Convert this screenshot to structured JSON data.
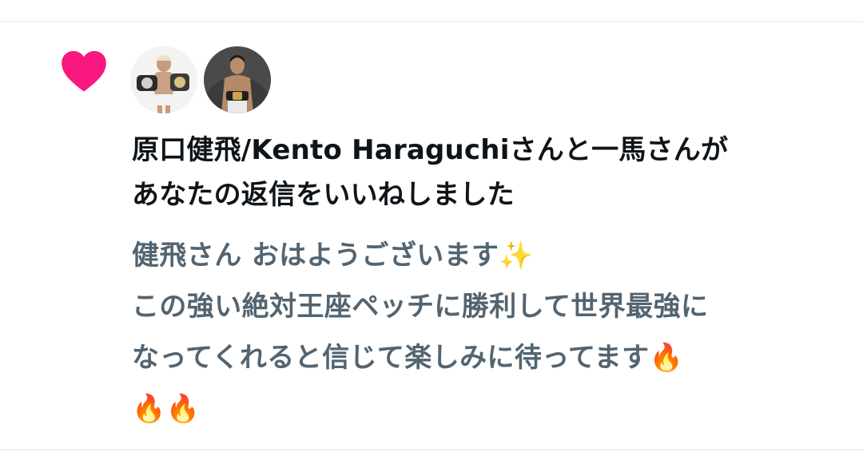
{
  "notification": {
    "type": "like",
    "heart_color": "#f91880",
    "icon": "heart-icon",
    "avatars": [
      {
        "name": "avatar-kento-haraguchi",
        "icon": "fighter-with-belts-avatar"
      },
      {
        "name": "avatar-kazuma",
        "icon": "fighter-with-belt-avatar"
      }
    ],
    "headline_line1": "原口健飛/Kento Haraguchiさんと一馬さんが",
    "headline_line2": "あなたの返信をいいねしました",
    "reply_lines": [
      "健飛さん おはようございます",
      "この強い絶対王座ペッチに勝利して世界最強に",
      "なってくれると信じて楽しみに待ってます"
    ],
    "emojis": {
      "sparkles": "✨",
      "fire": "🔥"
    }
  }
}
